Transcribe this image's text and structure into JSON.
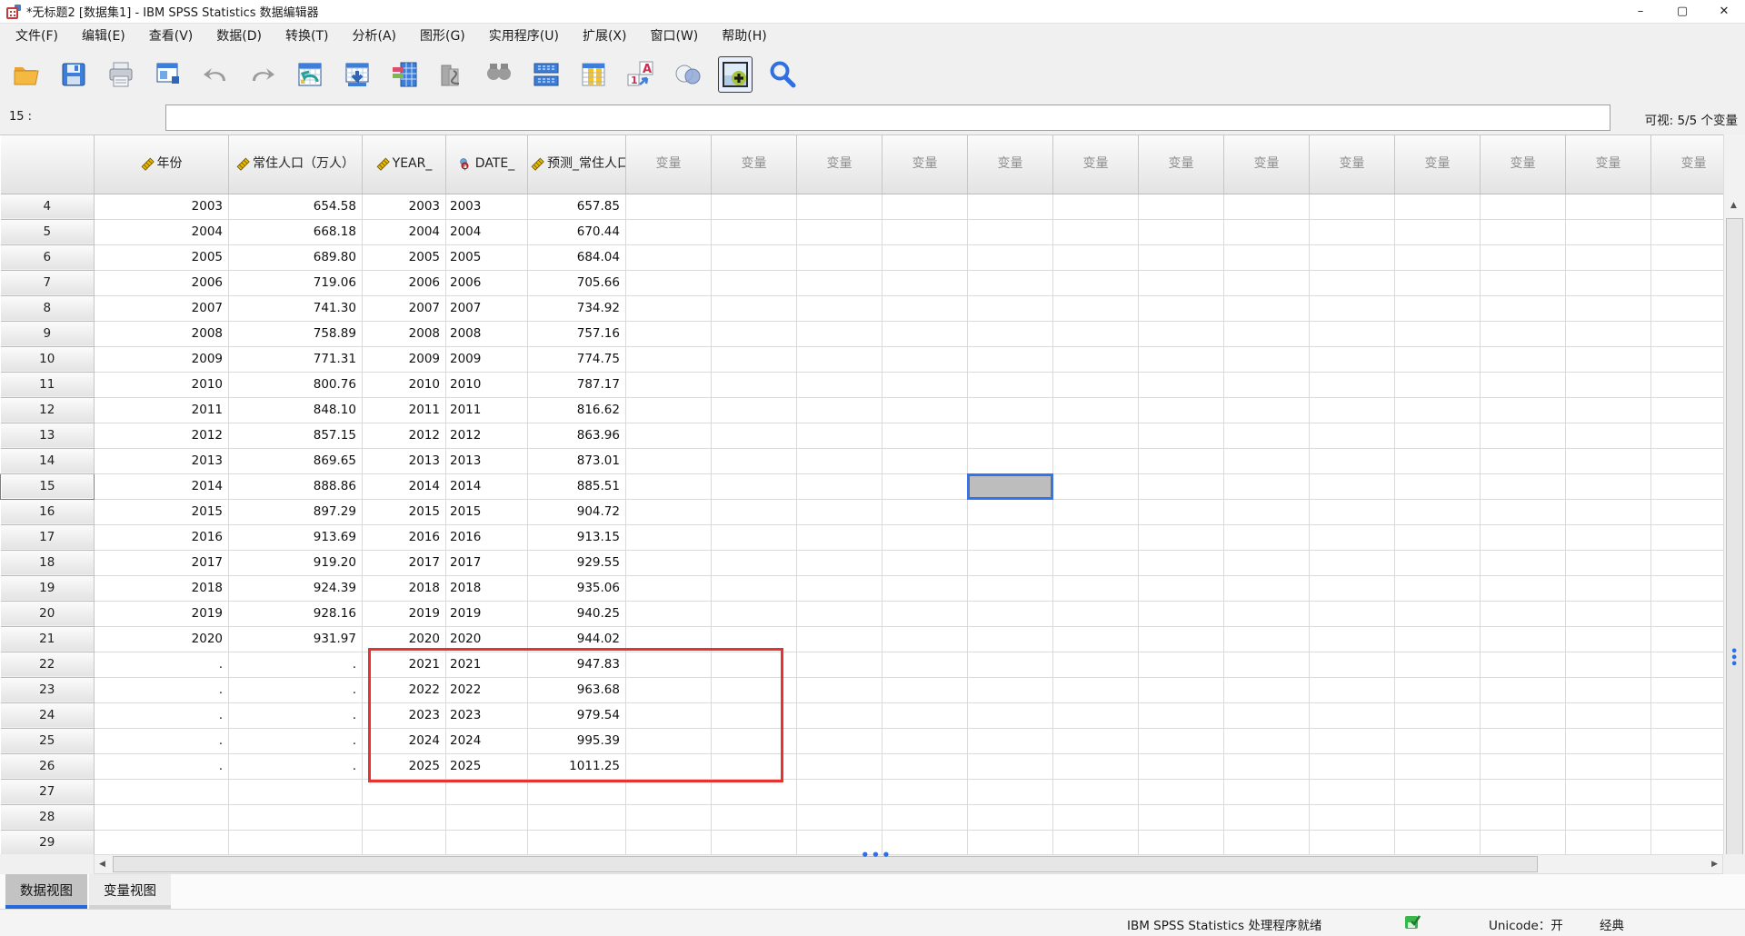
{
  "titlebar": {
    "title": "*无标题2 [数据集1] - IBM SPSS Statistics 数据编辑器",
    "minimize": "–",
    "maximize": "▢",
    "close": "✕"
  },
  "menu": {
    "items": [
      "文件(F)",
      "编辑(E)",
      "查看(V)",
      "数据(D)",
      "转换(T)",
      "分析(A)",
      "图形(G)",
      "实用程序(U)",
      "扩展(X)",
      "窗口(W)",
      "帮助(H)"
    ]
  },
  "toolbar": {
    "icons": [
      "open-data-file",
      "save-file",
      "print",
      "recall-dialogs",
      "undo",
      "redo",
      "goto-case",
      "goto-variable",
      "variables",
      "run-descriptives",
      "find",
      "insert-cases",
      "insert-variables",
      "value-labels",
      "select-cases",
      "use-variable-sets",
      "search"
    ]
  },
  "cellref": {
    "row_label": "15 :",
    "input_value": "",
    "visible_info": "可视: 5/5 个变量"
  },
  "grid": {
    "columns": [
      {
        "label": "年份",
        "measure": "scale"
      },
      {
        "label": "常住人口（万人）",
        "measure": "scale"
      },
      {
        "label": "YEAR_",
        "measure": "scale"
      },
      {
        "label": "DATE_",
        "measure": "nominal"
      },
      {
        "label": "预测_常住人口（万人）_...",
        "measure": "scale"
      }
    ],
    "variable_placeholder": "变量",
    "variable_column_count": 13,
    "rows": [
      {
        "n": "4",
        "cells": [
          "2003",
          "654.58",
          "2003",
          "2003",
          "657.85"
        ]
      },
      {
        "n": "5",
        "cells": [
          "2004",
          "668.18",
          "2004",
          "2004",
          "670.44"
        ]
      },
      {
        "n": "6",
        "cells": [
          "2005",
          "689.80",
          "2005",
          "2005",
          "684.04"
        ]
      },
      {
        "n": "7",
        "cells": [
          "2006",
          "719.06",
          "2006",
          "2006",
          "705.66"
        ]
      },
      {
        "n": "8",
        "cells": [
          "2007",
          "741.30",
          "2007",
          "2007",
          "734.92"
        ]
      },
      {
        "n": "9",
        "cells": [
          "2008",
          "758.89",
          "2008",
          "2008",
          "757.16"
        ]
      },
      {
        "n": "10",
        "cells": [
          "2009",
          "771.31",
          "2009",
          "2009",
          "774.75"
        ]
      },
      {
        "n": "11",
        "cells": [
          "2010",
          "800.76",
          "2010",
          "2010",
          "787.17"
        ]
      },
      {
        "n": "12",
        "cells": [
          "2011",
          "848.10",
          "2011",
          "2011",
          "816.62"
        ]
      },
      {
        "n": "13",
        "cells": [
          "2012",
          "857.15",
          "2012",
          "2012",
          "863.96"
        ]
      },
      {
        "n": "14",
        "cells": [
          "2013",
          "869.65",
          "2013",
          "2013",
          "873.01"
        ]
      },
      {
        "n": "15",
        "cells": [
          "2014",
          "888.86",
          "2014",
          "2014",
          "885.51"
        ],
        "current": true
      },
      {
        "n": "16",
        "cells": [
          "2015",
          "897.29",
          "2015",
          "2015",
          "904.72"
        ]
      },
      {
        "n": "17",
        "cells": [
          "2016",
          "913.69",
          "2016",
          "2016",
          "913.15"
        ]
      },
      {
        "n": "18",
        "cells": [
          "2017",
          "919.20",
          "2017",
          "2017",
          "929.55"
        ]
      },
      {
        "n": "19",
        "cells": [
          "2018",
          "924.39",
          "2018",
          "2018",
          "935.06"
        ]
      },
      {
        "n": "20",
        "cells": [
          "2019",
          "928.16",
          "2019",
          "2019",
          "940.25"
        ]
      },
      {
        "n": "21",
        "cells": [
          "2020",
          "931.97",
          "2020",
          "2020",
          "944.02"
        ]
      },
      {
        "n": "22",
        "cells": [
          ".",
          ".",
          "2021",
          "2021",
          "947.83"
        ]
      },
      {
        "n": "23",
        "cells": [
          ".",
          ".",
          "2022",
          "2022",
          "963.68"
        ]
      },
      {
        "n": "24",
        "cells": [
          ".",
          ".",
          "2023",
          "2023",
          "979.54"
        ]
      },
      {
        "n": "25",
        "cells": [
          ".",
          ".",
          "2024",
          "2024",
          "995.39"
        ]
      },
      {
        "n": "26",
        "cells": [
          ".",
          ".",
          "2025",
          "2025",
          "1011.25"
        ]
      },
      {
        "n": "27",
        "cells": [
          "",
          "",
          "",
          "",
          ""
        ]
      },
      {
        "n": "28",
        "cells": [
          "",
          "",
          "",
          "",
          ""
        ]
      },
      {
        "n": "29",
        "cells": [
          "",
          "",
          "",
          "",
          ""
        ]
      }
    ],
    "highlight_annotation": {
      "type": "red-rectangle",
      "rows": "22-26",
      "columns": "YEAR_ / DATE_ / 预测_常住人口（万人）_...",
      "color": "#e8322f"
    },
    "selected_cell": {
      "row": "15",
      "value": ""
    }
  },
  "tabs": {
    "items": [
      "数据视图",
      "变量视图"
    ],
    "active": "数据视图"
  },
  "statusbar": {
    "ready": "IBM SPSS Statistics 处理程序就绪",
    "unicode_label": "Unicode：开",
    "mode": "经典"
  },
  "colors": {
    "accent_blue": "#2468d9",
    "selection_border": "#3574f0",
    "annotation_red": "#e8322f",
    "measure_scale": "#e6b800"
  }
}
